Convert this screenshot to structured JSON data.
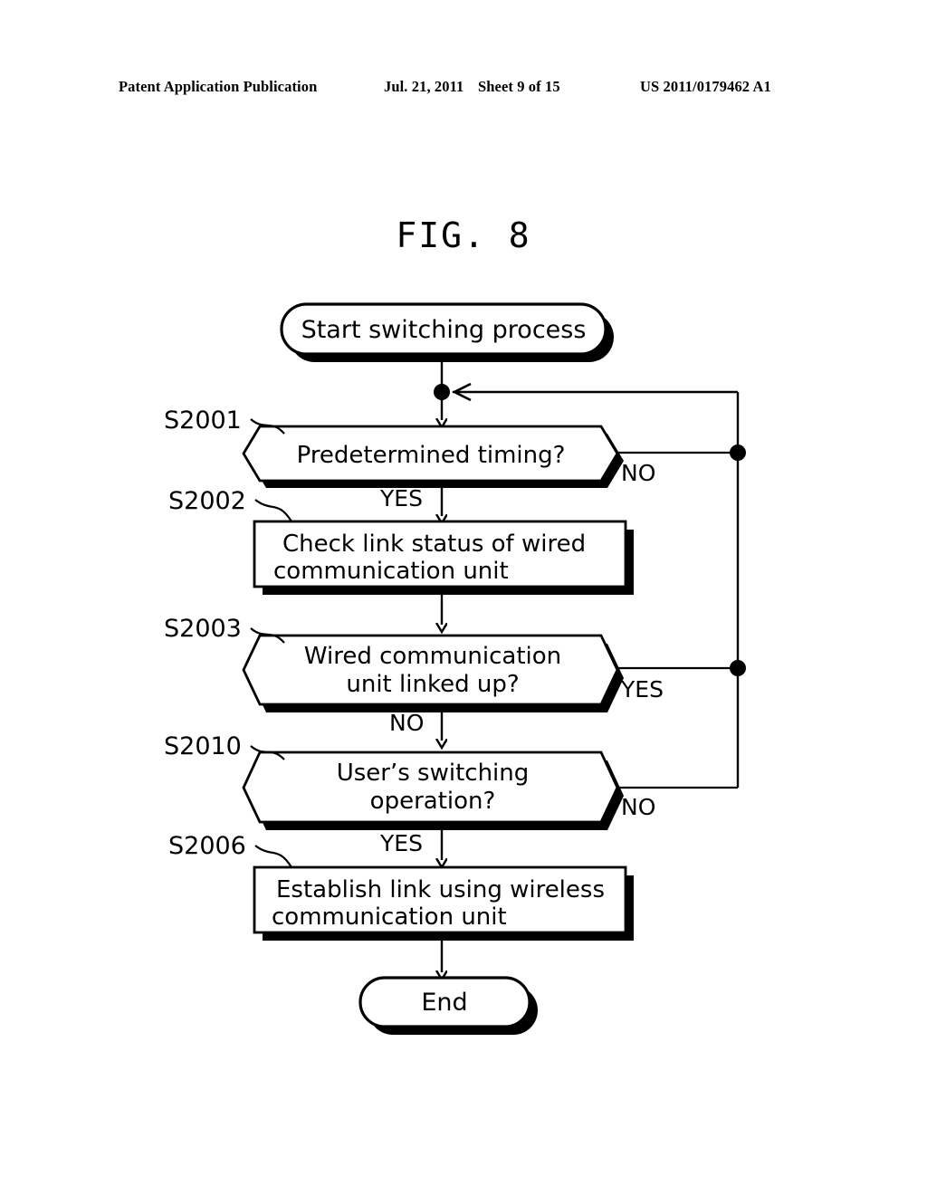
{
  "header": {
    "publication": "Patent Application Publication",
    "date": "Jul. 21, 2011",
    "sheet": "Sheet 9 of 15",
    "patent_number": "US 2011/0179462 A1"
  },
  "figure": {
    "title": "FIG. 8"
  },
  "chart_data": {
    "type": "diagram",
    "diagram_kind": "flowchart",
    "title": "FIG. 8",
    "nodes": [
      {
        "id": "start",
        "kind": "terminator",
        "label": "Start switching process",
        "step": ""
      },
      {
        "id": "s2001",
        "kind": "decision",
        "label": "Predetermined timing?",
        "step": "S2001"
      },
      {
        "id": "s2002",
        "kind": "process",
        "label_line1": "Check link status of wired",
        "label_line2": "communication unit",
        "step": "S2002"
      },
      {
        "id": "s2003",
        "kind": "decision",
        "label_line1": "Wired communication",
        "label_line2": "unit linked up?",
        "step": "S2003"
      },
      {
        "id": "s2010",
        "kind": "decision",
        "label_line1": "User’s switching",
        "label_line2": "operation?",
        "step": "S2010"
      },
      {
        "id": "s2006",
        "kind": "process",
        "label_line1": "Establish link using wireless",
        "label_line2": "communication unit",
        "step": "S2006"
      },
      {
        "id": "end",
        "kind": "terminator",
        "label": "End",
        "step": ""
      }
    ],
    "edges": [
      {
        "from": "start",
        "to": "s2001",
        "label": ""
      },
      {
        "from": "s2001",
        "to": "s2002",
        "label": "YES"
      },
      {
        "from": "s2001",
        "to": "start_junction",
        "label": "NO"
      },
      {
        "from": "s2002",
        "to": "s2003",
        "label": ""
      },
      {
        "from": "s2003",
        "to": "start_junction",
        "label": "YES"
      },
      {
        "from": "s2003",
        "to": "s2010",
        "label": "NO"
      },
      {
        "from": "s2010",
        "to": "start_junction",
        "label": "NO"
      },
      {
        "from": "s2010",
        "to": "s2006",
        "label": "YES"
      },
      {
        "from": "s2006",
        "to": "end",
        "label": ""
      }
    ]
  },
  "flow": {
    "start_label": "Start switching process",
    "end_label": "End",
    "s2001": {
      "step": "S2001",
      "text": "Predetermined timing?",
      "yes": "YES",
      "no": "NO"
    },
    "s2002": {
      "step": "S2002",
      "line1": "Check link status of wired",
      "line2": "communication unit"
    },
    "s2003": {
      "step": "S2003",
      "line1": "Wired communication",
      "line2": "unit linked up?",
      "yes": "YES",
      "no": "NO"
    },
    "s2010": {
      "step": "S2010",
      "line1": "User’s switching",
      "line2": "operation?",
      "yes": "YES",
      "no": "NO"
    },
    "s2006": {
      "step": "S2006",
      "line1": "Establish link using wireless",
      "line2": "communication unit"
    }
  },
  "colors": {
    "ink": "#000000",
    "paper": "#ffffff"
  }
}
